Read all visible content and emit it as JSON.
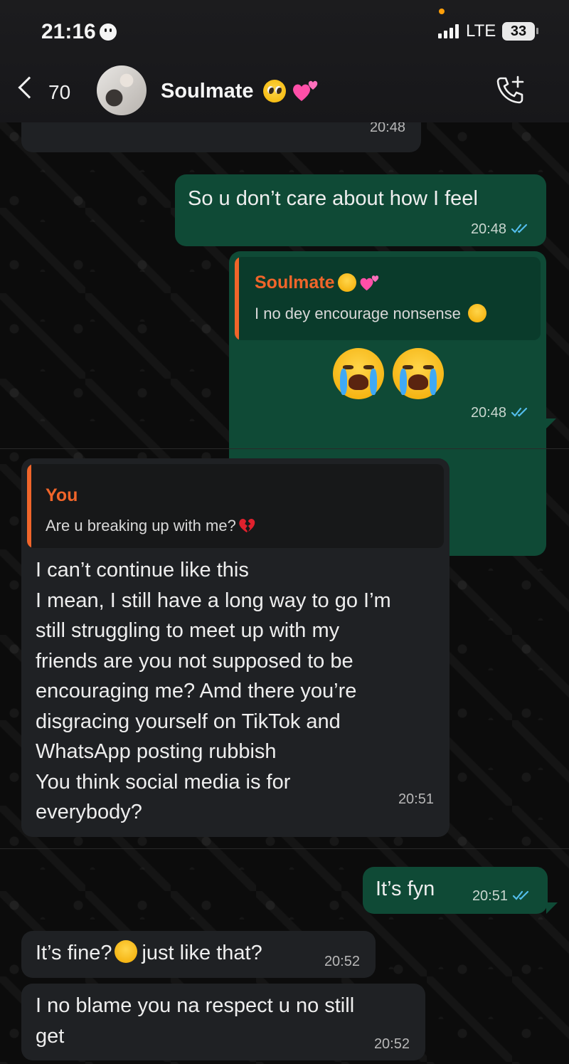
{
  "status_bar": {
    "time": "21:16",
    "network": "LTE",
    "battery": "33"
  },
  "header": {
    "back_count": "70",
    "contact_name": "Soulmate",
    "contact_emojis": [
      "pleading-face",
      "two-hearts"
    ]
  },
  "messages": [
    {
      "id": "m0",
      "direction": "in",
      "time": "20:48"
    },
    {
      "id": "m1",
      "direction": "out",
      "text": "So u don’t care about how I feel",
      "time": "20:48",
      "status": "read"
    },
    {
      "id": "m2",
      "direction": "out",
      "quote": {
        "name": "Soulmate",
        "text": "I no dey encourage nonsense"
      },
      "emojis": [
        "loudly-crying-face",
        "loudly-crying-face"
      ],
      "time": "20:48",
      "status": "read"
    },
    {
      "id": "m3",
      "direction": "in",
      "quote": {
        "name": "You",
        "text": "Are u breaking up with me?"
      },
      "lines": [
        "I can’t continue like this",
        "I mean, I still have a long way to go I’m",
        "still struggling to meet up with my",
        "friends are you not supposed to be",
        "encouraging me? Amd there you’re",
        "disgracing yourself on TikTok and",
        "WhatsApp posting rubbish",
        "You think social media is for",
        "everybody?"
      ],
      "time": "20:51"
    },
    {
      "id": "m4",
      "direction": "out",
      "text": "It’s fyn",
      "time": "20:51",
      "status": "read"
    },
    {
      "id": "m5",
      "direction": "in",
      "text_a": "It’s fine?",
      "text_b": "just like that?",
      "time": "20:52"
    },
    {
      "id": "m6",
      "direction": "in",
      "lines": [
        "I no blame you na respect u no still",
        "get"
      ],
      "time": "20:52"
    }
  ],
  "colors": {
    "incoming_bubble": "#1f2124",
    "outgoing_bubble": "#0f4a36",
    "quote_accent": "#f0652a",
    "read_ticks": "#53bdeb"
  }
}
